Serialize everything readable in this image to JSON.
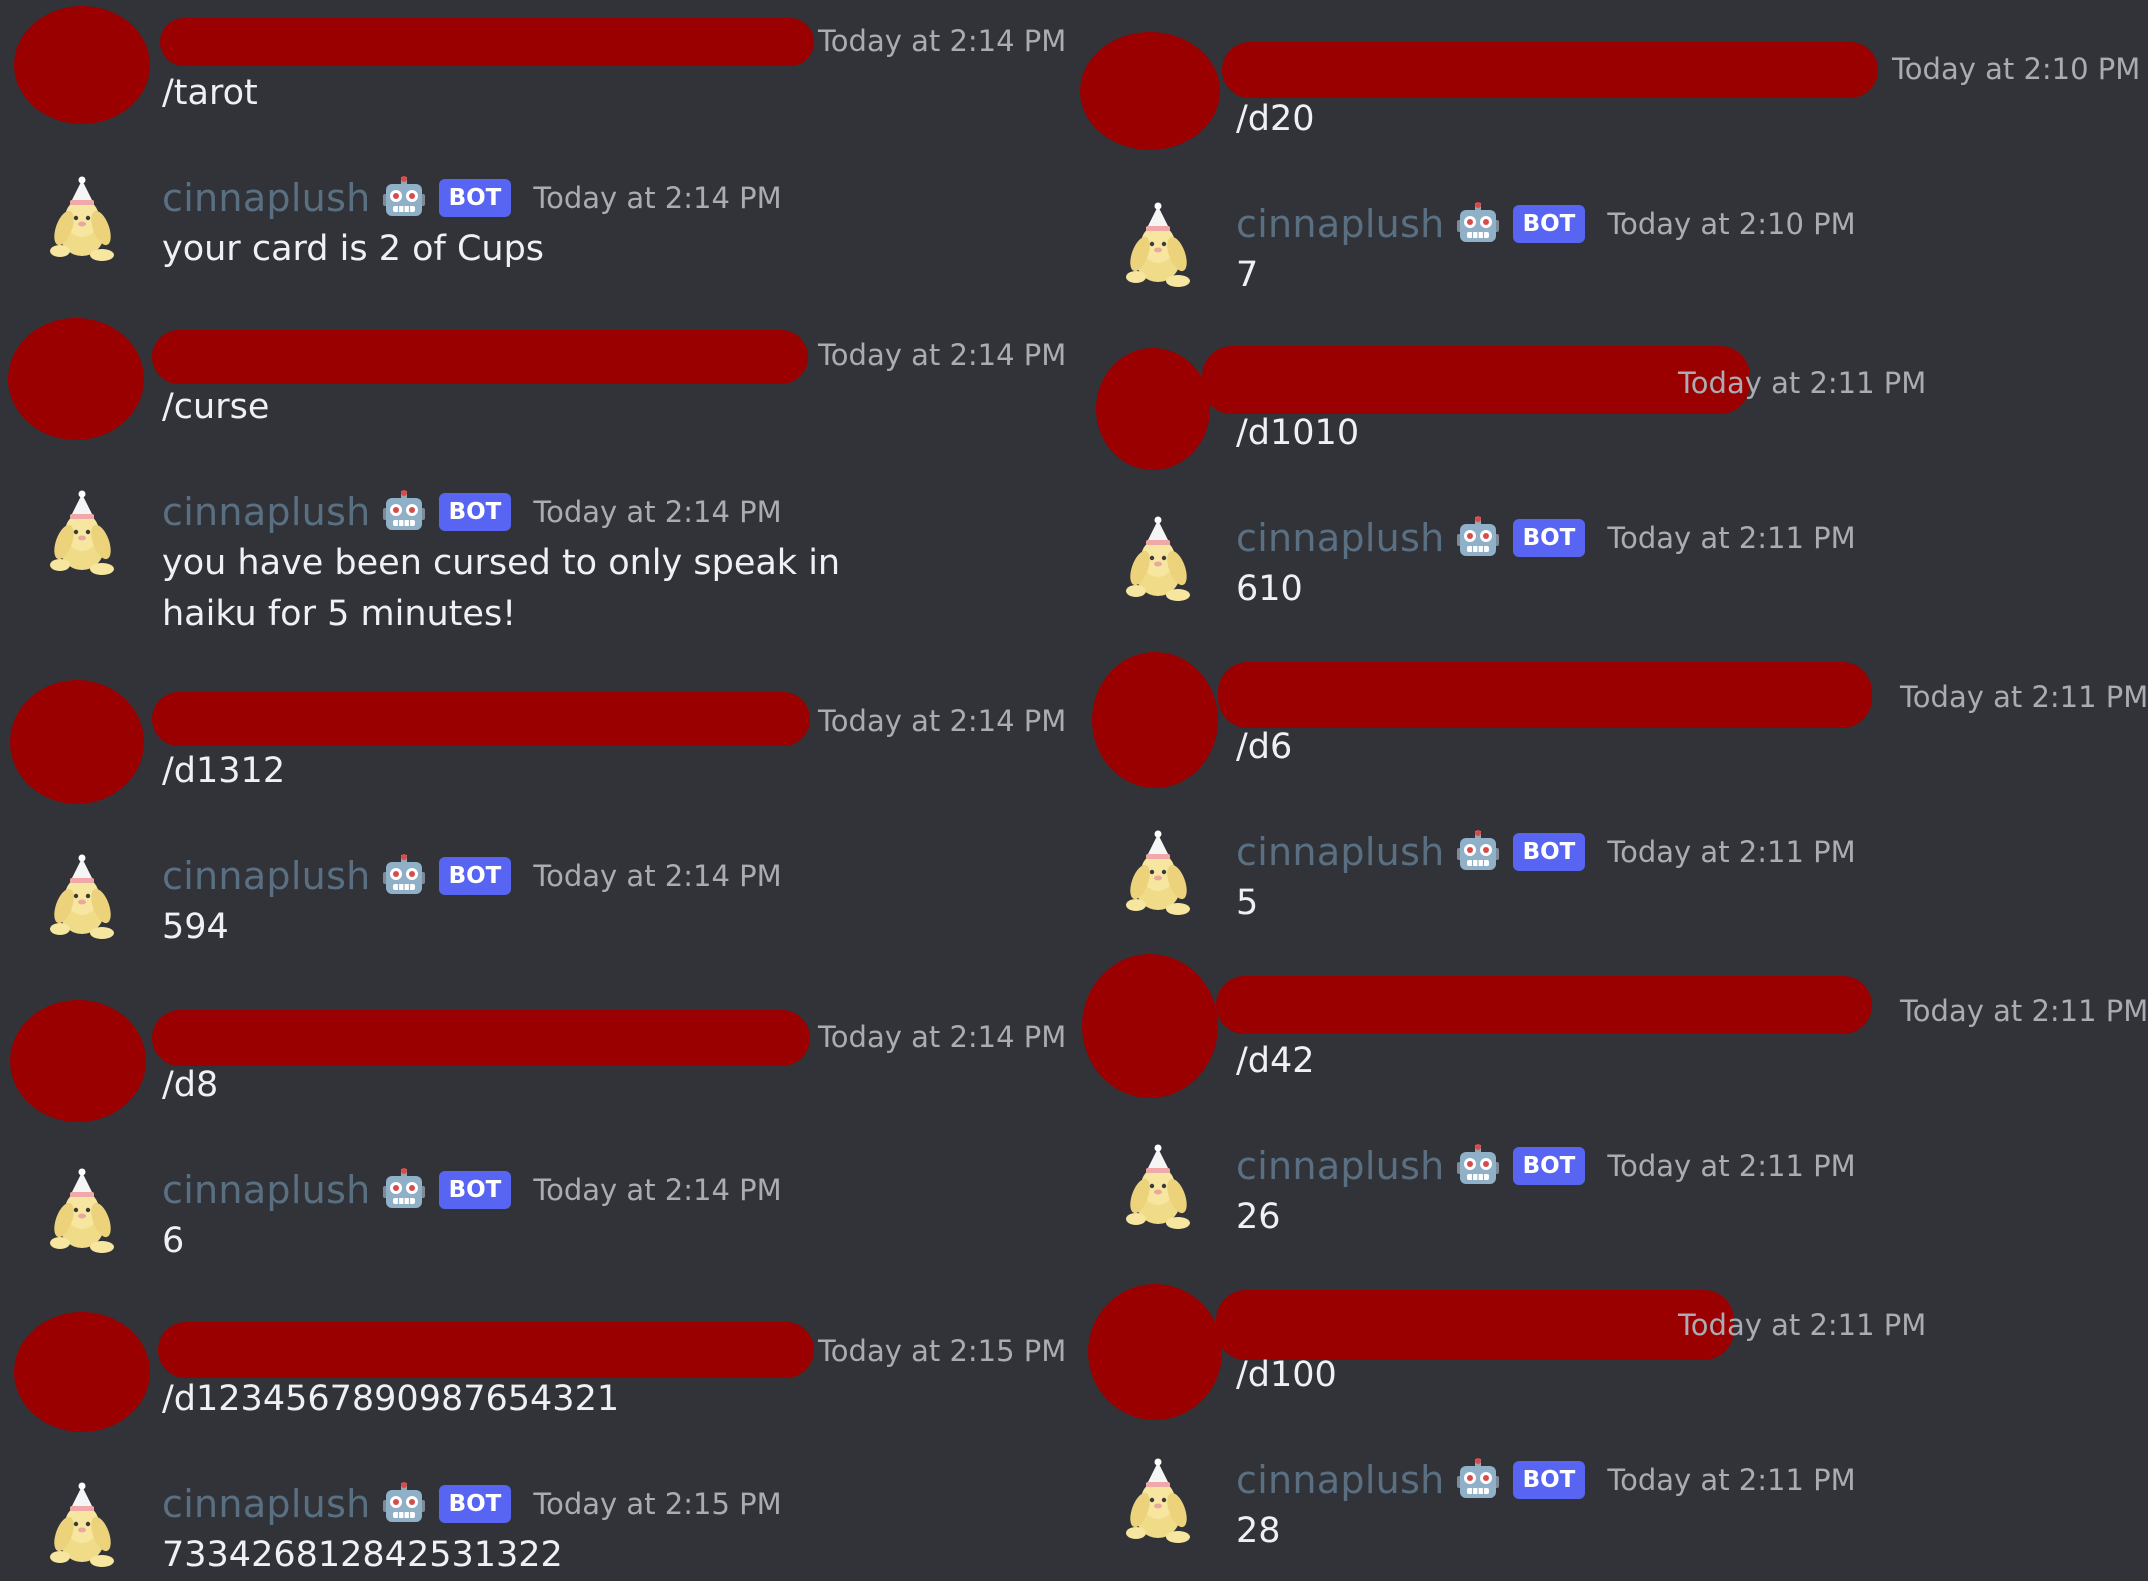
{
  "bot": {
    "name": "cinnaplush",
    "badge": "BOT",
    "robot_icon": "robot-face-emoji",
    "avatar_icon": "bunny-plush-with-party-hat"
  },
  "redaction_color": "#9b0000",
  "colors": {
    "background": "#313338",
    "badge": "#5865f2",
    "bot_name": "#5a7082",
    "timestamp": "#a9acb3",
    "text": "#eef0f3"
  },
  "left_messages": [
    {
      "timestamp": "Today at 2:14 PM",
      "text": "/tarot"
    },
    {
      "timestamp": "Today at 2:14 PM",
      "text": "your card is 2 of Cups"
    },
    {
      "timestamp": "Today at 2:14 PM",
      "text": "/curse"
    },
    {
      "timestamp": "Today at 2:14 PM",
      "text": "you have been cursed to only speak in haiku for 5 minutes!"
    },
    {
      "timestamp": "Today at 2:14 PM",
      "text": "/d1312"
    },
    {
      "timestamp": "Today at 2:14 PM",
      "text": "594"
    },
    {
      "timestamp": "Today at 2:14 PM",
      "text": "/d8"
    },
    {
      "timestamp": "Today at 2:14 PM",
      "text": "6"
    },
    {
      "timestamp": "Today at 2:15 PM",
      "text": "/d1234567890987654321"
    },
    {
      "timestamp": "Today at 2:15 PM",
      "text": "733426812842531322"
    }
  ],
  "right_messages": [
    {
      "timestamp": "Today at 2:10 PM",
      "text": "/d20"
    },
    {
      "timestamp": "Today at 2:10 PM",
      "text": "7"
    },
    {
      "timestamp": "Today at 2:11 PM",
      "text": "/d1010"
    },
    {
      "timestamp": "Today at 2:11 PM",
      "text": "610"
    },
    {
      "timestamp": "Today at 2:11 PM",
      "text": "/d6"
    },
    {
      "timestamp": "Today at 2:11 PM",
      "text": "5"
    },
    {
      "timestamp": "Today at 2:11 PM",
      "text": "/d42"
    },
    {
      "timestamp": "Today at 2:11 PM",
      "text": "26"
    },
    {
      "timestamp": "Today at 2:11 PM",
      "text": "/d100"
    },
    {
      "timestamp": "Today at 2:11 PM",
      "text": "28"
    }
  ]
}
